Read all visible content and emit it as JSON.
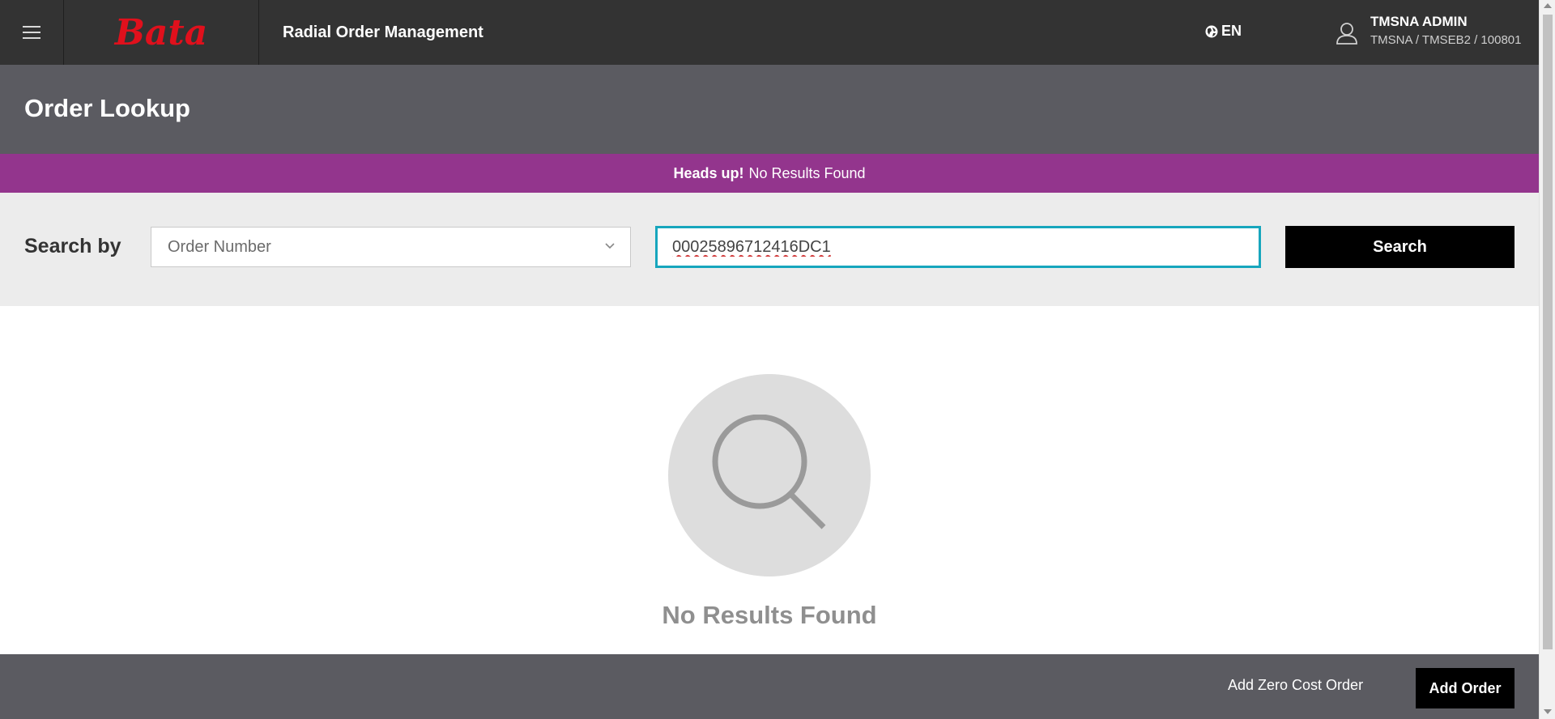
{
  "header": {
    "logo_text": "Bata",
    "app_title": "Radial Order Management",
    "language": "EN",
    "user_name": "TMSNA ADMIN",
    "user_org": "TMSNA / TMSEB2 / 100801"
  },
  "page": {
    "title": "Order Lookup"
  },
  "alert": {
    "strong": "Heads up!",
    "message": "No Results Found"
  },
  "search": {
    "label": "Search by",
    "select_value": "Order Number",
    "input_value": "00025896712416DC1",
    "button_label": "Search"
  },
  "empty_state": {
    "message": "No Results Found"
  },
  "footer": {
    "zero_cost_label": "Add Zero Cost Order",
    "add_order_label": "Add Order"
  },
  "colors": {
    "topbar": "#333333",
    "header": "#5b5b61",
    "alert": "#93358d",
    "input_border": "#17a6bd",
    "brand_red": "#e0101c"
  }
}
